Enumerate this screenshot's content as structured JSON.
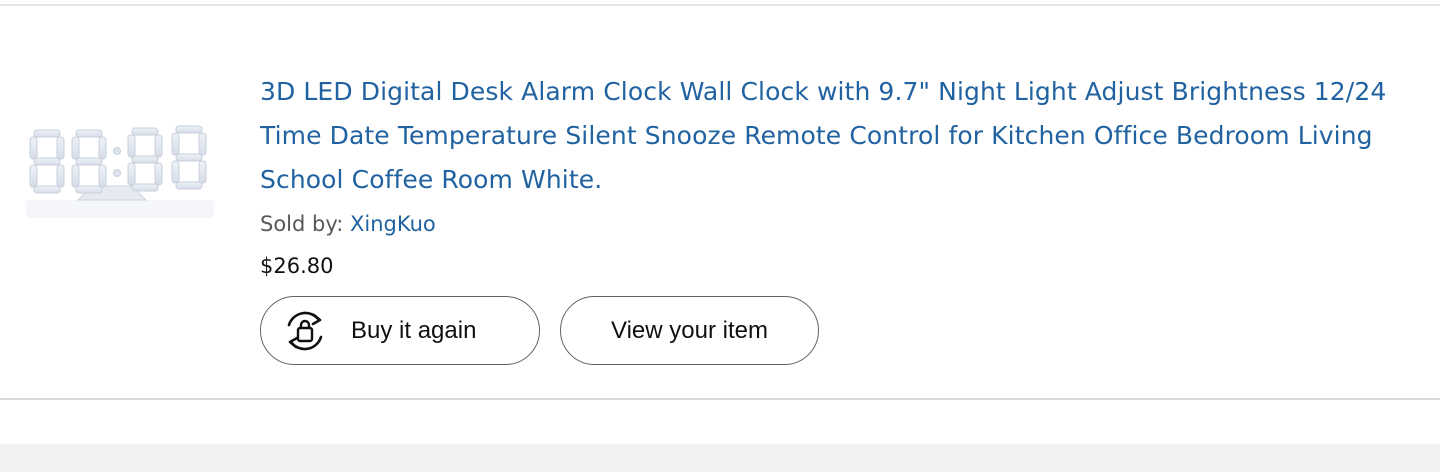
{
  "order_item": {
    "title": "3D LED Digital Desk Alarm Clock Wall Clock with 9.7\" Night Light Adjust Brightness 12/24 Time Date Temperature Silent Snooze Remote Control for Kitchen Office Bedroom Living School Coffee Room White.",
    "sold_by_label": "Sold by:",
    "seller": "XingKuo",
    "price": "$26.80",
    "image_icon": "led-clock-product-image"
  },
  "actions": {
    "buy_again_label": "Buy it again",
    "buy_again_icon": "reorder-bag-icon",
    "view_item_label": "View your item"
  },
  "colors": {
    "link": "#2162a1",
    "text": "#0f1111",
    "muted_text": "#565959",
    "border": "#5f6368",
    "footer_background": "#f0f2f2"
  }
}
